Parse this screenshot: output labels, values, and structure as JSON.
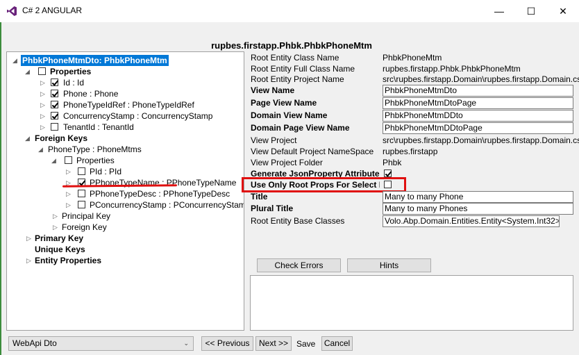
{
  "window": {
    "title": "C# 2 ANGULAR",
    "minimize": "—",
    "maximize": "☐",
    "close": "✕"
  },
  "form_title": "rupbes.firstapp.Phbk.PhbkPhoneMtm",
  "tree": {
    "root": "PhbkPhoneMtmDto: PhbkPhoneMtm",
    "properties": "Properties",
    "prop_id": "Id : Id",
    "prop_phone": "Phone : Phone",
    "prop_phonetype": "PhoneTypeIdRef : PhoneTypeIdRef",
    "prop_concurrency": "ConcurrencyStamp : ConcurrencyStamp",
    "prop_tenant": "TenantId : TenantId",
    "foreign_keys": "Foreign Keys",
    "fk_phonetype": "PhoneType : PhoneMtms",
    "fk_properties": "Properties",
    "fk_pid": "PId : PId",
    "fk_pphonetypename": "PPhoneTypeName : PPhoneTypeName",
    "fk_pphonetypedesc": "PPhoneTypeDesc : PPhoneTypeDesc",
    "fk_pconcurrency": "PConcurrencyStamp : PConcurrencyStamp",
    "principal_key": "Principal Key",
    "foreign_key": "Foreign Key",
    "primary_key": "Primary Key",
    "unique_keys": "Unique Keys",
    "entity_properties": "Entity Properties"
  },
  "props": {
    "root_entity_class_name": {
      "label": "Root Entity Class Name",
      "value": "PhbkPhoneMtm"
    },
    "root_entity_full_class_name": {
      "label": "Root Entity Full Class Name",
      "value": "rupbes.firstapp.Phbk.PhbkPhoneMtm"
    },
    "root_entity_project_name": {
      "label": "Root Entity Project Name",
      "value": "src\\rupbes.firstapp.Domain\\rupbes.firstapp.Domain.csproj"
    },
    "view_name": {
      "label": "View Name",
      "value": "PhbkPhoneMtmDto"
    },
    "page_view_name": {
      "label": "Page View Name",
      "value": "PhbkPhoneMtmDtoPage"
    },
    "domain_view_name": {
      "label": "Domain View Name",
      "value": "PhbkPhoneMtmDDto"
    },
    "domain_page_view_name": {
      "label": "Domain Page View Name",
      "value": "PhbkPhoneMtmDDtoPage"
    },
    "view_project": {
      "label": "View Project",
      "value": "src\\rupbes.firstapp.Domain\\rupbes.firstapp.Domain.csproj"
    },
    "view_default_namespace": {
      "label": "View Default Project NameSpace",
      "value": "rupbes.firstapp"
    },
    "view_project_folder": {
      "label": "View Project Folder",
      "value": "Phbk"
    },
    "generate_json": {
      "label": "Generate JsonProperty Attribute"
    },
    "use_only_root_props": {
      "label": "Use Only Root Props For Select Me"
    },
    "title": {
      "label": "Title",
      "value": "Many to many Phone"
    },
    "plural_title": {
      "label": "Plural Title",
      "value": "Many to many Phones"
    },
    "root_entity_base_classes": {
      "label": "Root Entity Base Classes",
      "value": "Volo.Abp.Domain.Entities.Entity<System.Int32>"
    }
  },
  "buttons": {
    "check_errors": "Check Errors",
    "hints": "Hints",
    "previous": "<< Previous",
    "next": "Next >>",
    "save": "Save",
    "cancel": "Cancel"
  },
  "select": {
    "value": "WebApi Dto"
  },
  "colors": {
    "selection": "#0078d7",
    "annotation": "#e01010",
    "accent_strip": "#3c8c3c"
  }
}
